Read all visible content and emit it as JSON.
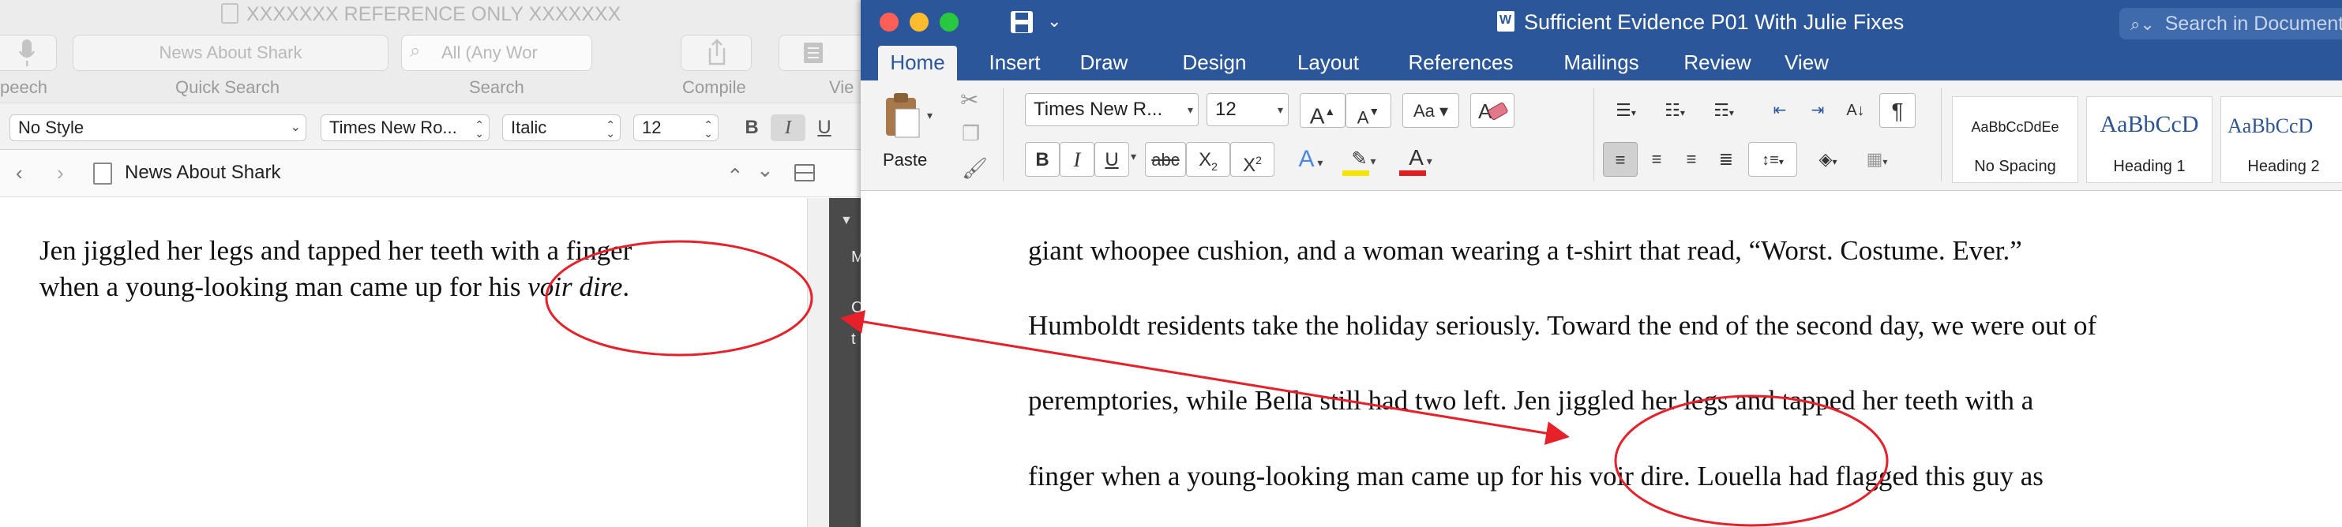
{
  "scrivener": {
    "window_title": "XXXXXXX REFERENCE ONLY XXXXXXX",
    "toolbar": {
      "speech_label": "peech",
      "quick_search_value": "News About Shark",
      "quick_search_label": "Quick Search",
      "search_placeholder": "All (Any Wor",
      "search_label": "Search",
      "compile_label": "Compile",
      "view_label": "Vie"
    },
    "format_bar": {
      "style": "No Style",
      "font": "Times New Ro...",
      "typeface": "Italic",
      "size": "12",
      "bold": "B",
      "italic": "I",
      "underline": "U"
    },
    "nav": {
      "back": "‹",
      "forward": "›",
      "doc_title": "News About Shark",
      "up": "⌃",
      "down": "⌄"
    },
    "editor": {
      "line1": "Jen jiggled her legs and tapped her teeth with a finger",
      "line2_start": "when a young-looking man came up for his ",
      "line2_italic": "voir dire",
      "line2_end": "."
    },
    "inspector_glyphs": [
      "M",
      "C",
      "t"
    ]
  },
  "word": {
    "window_title": "Sufficient Evidence P01 With Julie Fixes",
    "search_placeholder": "Search in Document",
    "tabs": [
      "Home",
      "Insert",
      "Draw",
      "Design",
      "Layout",
      "References",
      "Mailings",
      "Review",
      "View"
    ],
    "active_tab": "Home",
    "ribbon": {
      "paste_label": "Paste",
      "font_name": "Times New R...",
      "font_size": "12",
      "bold": "B",
      "italic": "I",
      "underline": "U",
      "strikethrough": "abc",
      "subscript": "X",
      "subscript_mark": "2",
      "superscript": "X",
      "superscript_mark": "2",
      "grow_font": "A",
      "shrink_font": "A",
      "change_case": "Aa",
      "text_effects": "A",
      "font_color": "A",
      "paragraph_mark": "¶",
      "styles": [
        {
          "preview": "AaBbCcDdEe",
          "name": "No Spacing"
        },
        {
          "preview": "AaBbCcD",
          "name": "Heading 1"
        },
        {
          "preview": "AaBbCcD",
          "name": "Heading 2"
        }
      ]
    },
    "document_lines": [
      "giant whoopee cushion, and a woman wearing a t-shirt that read, “Worst. Costume. Ever.”",
      "Humboldt residents take the holiday seriously. Toward the end of the second day, we were out of",
      "peremptories, while Bella still had two left. Jen jiggled her legs and tapped her teeth with a",
      "finger when a young-looking man came up for his voir dire. Louella had flagged this guy as"
    ]
  },
  "colors": {
    "word_blue": "#2b579a",
    "annotation_red": "#e8202a",
    "highlight_yellow": "#f5e500",
    "font_color_red": "#e02020"
  }
}
